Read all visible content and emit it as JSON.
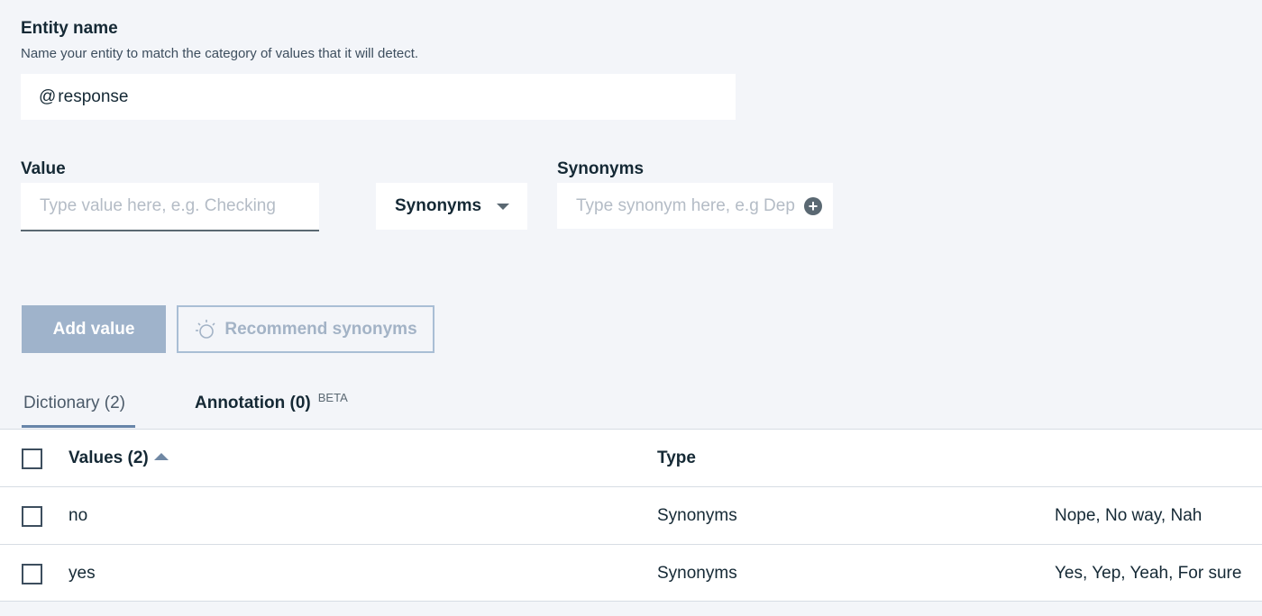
{
  "entity": {
    "title": "Entity name",
    "helper": "Name your entity to match the category of values that it will detect.",
    "prefix": "@",
    "value": "response"
  },
  "value_field": {
    "label": "Value",
    "placeholder": "Type value here, e.g. Checking"
  },
  "type_select": {
    "selected": "Synonyms"
  },
  "synonyms_field": {
    "label": "Synonyms",
    "placeholder": "Type synonym here, e.g Dep"
  },
  "buttons": {
    "add_value": "Add value",
    "recommend": "Recommend synonyms"
  },
  "tabs": {
    "dictionary": "Dictionary (2)",
    "annotation": "Annotation (0)",
    "annotation_badge": "BETA"
  },
  "table": {
    "headers": {
      "values": "Values (2)",
      "type": "Type"
    },
    "rows": [
      {
        "value": "no",
        "type": "Synonyms",
        "synonyms": "Nope, No way, Nah"
      },
      {
        "value": "yes",
        "type": "Synonyms",
        "synonyms": "Yes, Yep, Yeah, For sure"
      }
    ]
  },
  "colors": {
    "background": "#f3f5f9",
    "primary_disabled": "#9fb3cb",
    "tab_indicator": "#6785a9"
  }
}
